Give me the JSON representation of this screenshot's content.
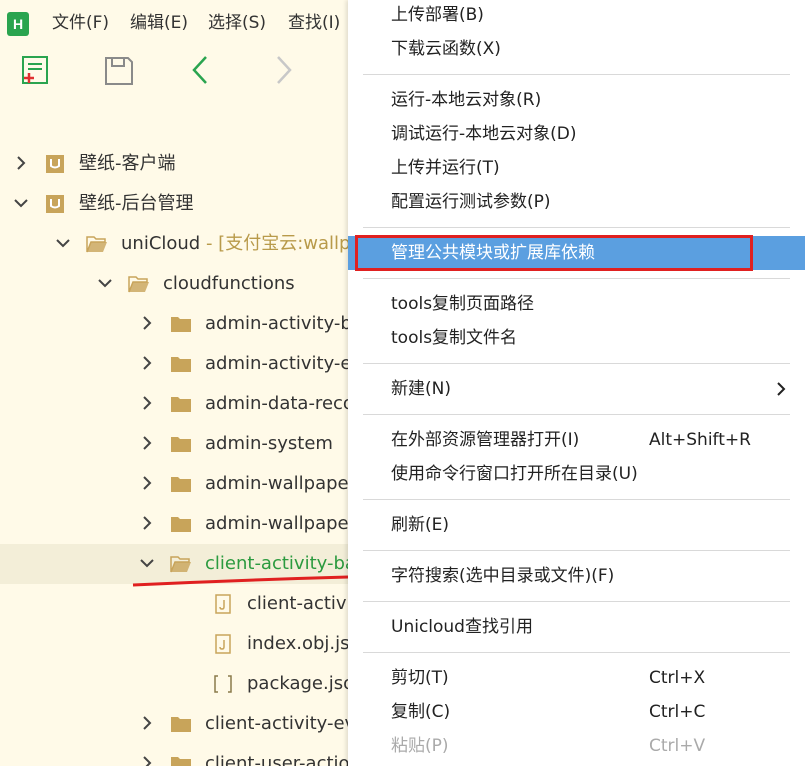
{
  "app": {
    "logo_letter": "H"
  },
  "menubar": [
    "文件(F)",
    "编辑(E)",
    "选择(S)",
    "查找(I)"
  ],
  "toolbar": {
    "icons": [
      "new-file-icon",
      "save-icon",
      "back-arrow-icon",
      "forward-arrow-icon"
    ]
  },
  "tree": [
    {
      "label": "壁纸-客户端",
      "expanded": false,
      "icon": "project-icon"
    },
    {
      "label": "壁纸-后台管理",
      "expanded": true,
      "icon": "project-icon"
    },
    {
      "label": "uniCloud",
      "suffix": " - [支付宝云:wallp",
      "expanded": true,
      "icon": "open-folder-icon"
    },
    {
      "label": "cloudfunctions",
      "expanded": true,
      "icon": "open-folder-icon"
    },
    {
      "label": "admin-activity-b",
      "expanded": false,
      "icon": "folder-icon"
    },
    {
      "label": "admin-activity-e",
      "expanded": false,
      "icon": "folder-icon"
    },
    {
      "label": "admin-data-reco",
      "expanded": false,
      "icon": "folder-icon"
    },
    {
      "label": "admin-system",
      "expanded": false,
      "icon": "folder-icon"
    },
    {
      "label": "admin-wallpaper",
      "expanded": false,
      "icon": "folder-icon"
    },
    {
      "label": "admin-wallpaper",
      "expanded": false,
      "icon": "folder-icon"
    },
    {
      "label": "client-activity-ba",
      "expanded": true,
      "icon": "open-folder-icon",
      "selected": true
    },
    {
      "label": "client-activit",
      "icon": "js-file-icon"
    },
    {
      "label": "index.obj.js",
      "icon": "js-file-icon"
    },
    {
      "label": "package.jso",
      "icon": "json-file-icon"
    },
    {
      "label": "client-activity-ev",
      "expanded": false,
      "icon": "folder-icon"
    },
    {
      "label": "client-user-actio",
      "expanded": false,
      "icon": "folder-icon"
    }
  ],
  "context_menu": {
    "groups": [
      [
        {
          "label": "上传部署(B)"
        },
        {
          "label": "下载云函数(X)"
        }
      ],
      [
        {
          "label": "运行-本地云对象(R)"
        },
        {
          "label": "调试运行-本地云对象(D)"
        },
        {
          "label": "上传并运行(T)"
        },
        {
          "label": "配置运行测试参数(P)"
        }
      ],
      [
        {
          "label": "管理公共模块或扩展库依赖",
          "highlighted": true
        }
      ],
      [
        {
          "label": "tools复制页面路径"
        },
        {
          "label": "tools复制文件名"
        }
      ],
      [
        {
          "label": "新建(N)",
          "submenu": true
        }
      ],
      [
        {
          "label": "在外部资源管理器打开(I)",
          "shortcut": "Alt+Shift+R"
        },
        {
          "label": "使用命令行窗口打开所在目录(U)"
        }
      ],
      [
        {
          "label": "刷新(E)"
        }
      ],
      [
        {
          "label": "字符搜索(选中目录或文件)(F)"
        }
      ],
      [
        {
          "label": "Unicloud查找引用"
        }
      ],
      [
        {
          "label": "剪切(T)",
          "shortcut": "Ctrl+X"
        },
        {
          "label": "复制(C)",
          "shortcut": "Ctrl+C"
        },
        {
          "label": "粘贴(P)",
          "shortcut": "Ctrl+V",
          "disabled": true
        }
      ]
    ]
  },
  "colors": {
    "sidebar_bg": "#fffae8",
    "highlight": "#5b9fe0",
    "annotation_red": "#e02020",
    "folder": "#c8a45a",
    "selected_text": "#2b9a3f"
  }
}
